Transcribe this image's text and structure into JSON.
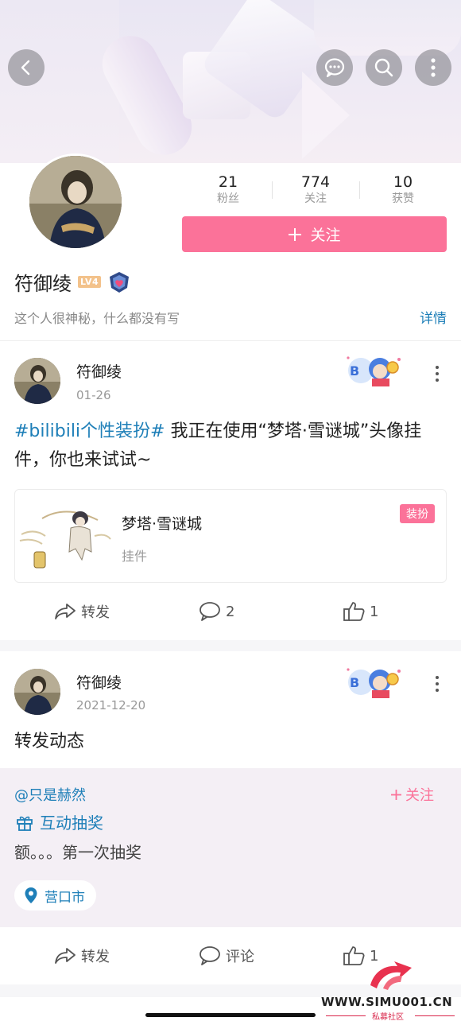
{
  "header": {
    "back_icon": "chevron-left-icon",
    "actions": [
      "chat-bubble-icon",
      "search-icon",
      "more-vertical-icon"
    ]
  },
  "profile": {
    "stats": [
      {
        "value": "21",
        "label": "粉丝"
      },
      {
        "value": "774",
        "label": "关注"
      },
      {
        "value": "10",
        "label": "获赞"
      }
    ],
    "follow_button": "关注",
    "name": "符御绫",
    "level": "LV4",
    "bio": "这个人很神秘，什么都没有写",
    "detail_link": "详情"
  },
  "posts": [
    {
      "author": "符御绫",
      "date": "01-26",
      "tag": "#bilibili个性装扮#",
      "text": " 我正在使用“梦塔·雪谜城”头像挂件，你也来试试~",
      "item": {
        "title": "梦塔·雪谜城",
        "subtitle": "挂件",
        "badge": "装扮"
      },
      "actions": {
        "forward": "转发",
        "comment": "2",
        "like": "1"
      }
    },
    {
      "author": "符御绫",
      "date": "2021-12-20",
      "text": "转发动态",
      "repost": {
        "user": "@只是赫然",
        "follow": "关注",
        "lottery": "互动抽奖",
        "content": "额。。。第一次抽奖",
        "location": "营口市"
      },
      "actions": {
        "forward": "转发",
        "comment": "评论",
        "like": "1"
      }
    }
  ],
  "watermark": {
    "url": "WWW.SIMU001.CN",
    "name": "私募社区"
  },
  "colors": {
    "accent": "#fb7299",
    "link": "#1e7fb8"
  }
}
